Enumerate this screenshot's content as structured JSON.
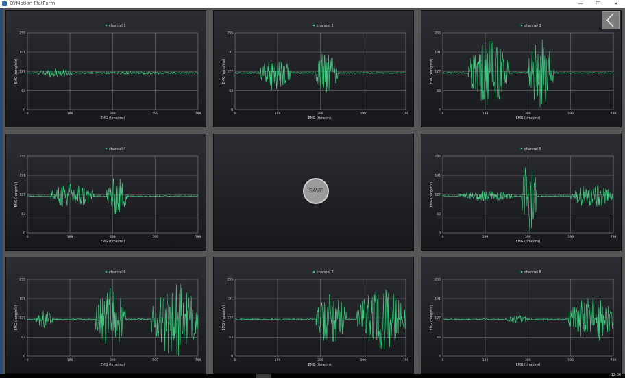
{
  "window": {
    "title": "OYMotion PlatForm",
    "minimize_icon": "—",
    "maximize_icon": "❐",
    "close_icon": "✕"
  },
  "back_button": {
    "icon": "chevron-left-icon"
  },
  "save_button": {
    "label": "SAVE"
  },
  "taskbar": {
    "clock": "12:00"
  },
  "colors": {
    "signal": "#3fc97f",
    "grid": "#6b6e76",
    "axis_text": "#d8d8d8",
    "panel_top": "#2b2d32",
    "panel_bottom": "#17181b"
  },
  "chart_data": [
    {
      "type": "line",
      "legend": "channel 1",
      "xlabel": "EMG (time/ms)",
      "ylabel": "EMG (rang/mV)",
      "xlim": [
        0,
        799
      ],
      "ylim": [
        0,
        255
      ],
      "x_ticks": [
        "0",
        "199",
        "399",
        "599",
        "799"
      ],
      "y_ticks": [
        "0",
        "63",
        "127",
        "191",
        "255"
      ],
      "baseline": 122,
      "bursts": [
        {
          "start": 50,
          "end": 210,
          "amp": 14
        },
        {
          "start": 210,
          "end": 799,
          "amp": 4
        }
      ]
    },
    {
      "type": "line",
      "legend": "channel 2",
      "xlabel": "EMG (time/ms)",
      "ylabel": "EMG (rang/mV)",
      "xlim": [
        0,
        799
      ],
      "ylim": [
        0,
        255
      ],
      "x_ticks": [
        "0",
        "199",
        "399",
        "599",
        "799"
      ],
      "y_ticks": [
        "0",
        "63",
        "127",
        "191",
        "255"
      ],
      "baseline": 122,
      "bursts": [
        {
          "start": 120,
          "end": 260,
          "amp": 60
        },
        {
          "start": 380,
          "end": 480,
          "amp": 75
        }
      ]
    },
    {
      "type": "line",
      "legend": "channel 3",
      "xlabel": "EMG (time/ms)",
      "ylabel": "EMG (rang/mV)",
      "xlim": [
        0,
        799
      ],
      "ylim": [
        0,
        255
      ],
      "x_ticks": [
        "0",
        "199",
        "399",
        "599",
        "799"
      ],
      "y_ticks": [
        "0",
        "63",
        "127",
        "191",
        "255"
      ],
      "baseline": 122,
      "bursts": [
        {
          "start": 120,
          "end": 310,
          "amp": 110
        },
        {
          "start": 400,
          "end": 520,
          "amp": 120
        }
      ]
    },
    {
      "type": "line",
      "legend": "channel 4",
      "xlabel": "EMG (time/ms)",
      "ylabel": "EMG (rang/mV)",
      "xlim": [
        0,
        799
      ],
      "ylim": [
        0,
        255
      ],
      "x_ticks": [
        "0",
        "199",
        "399",
        "599",
        "799"
      ],
      "y_ticks": [
        "0",
        "63",
        "127",
        "191",
        "255"
      ],
      "baseline": 122,
      "bursts": [
        {
          "start": 110,
          "end": 310,
          "amp": 45
        },
        {
          "start": 370,
          "end": 470,
          "amp": 65
        }
      ]
    },
    null,
    {
      "type": "line",
      "legend": "channel 5",
      "xlabel": "EMG (time/ms)",
      "ylabel": "EMG (rang/mV)",
      "xlim": [
        0,
        799
      ],
      "ylim": [
        0,
        255
      ],
      "x_ticks": [
        "0",
        "199",
        "399",
        "599",
        "799"
      ],
      "y_ticks": [
        "0",
        "63",
        "127",
        "191",
        "255"
      ],
      "baseline": 122,
      "bursts": [
        {
          "start": 80,
          "end": 330,
          "amp": 18
        },
        {
          "start": 370,
          "end": 440,
          "amp": 125
        },
        {
          "start": 600,
          "end": 799,
          "amp": 40
        }
      ]
    },
    {
      "type": "line",
      "legend": "channel 6",
      "xlabel": "EMG (time/ms)",
      "ylabel": "EMG (rang/mV)",
      "xlim": [
        0,
        799
      ],
      "ylim": [
        0,
        255
      ],
      "x_ticks": [
        "0",
        "199",
        "399",
        "599",
        "799"
      ],
      "y_ticks": [
        "0",
        "63",
        "127",
        "191",
        "255"
      ],
      "baseline": 122,
      "bursts": [
        {
          "start": 40,
          "end": 120,
          "amp": 30
        },
        {
          "start": 320,
          "end": 460,
          "amp": 105
        },
        {
          "start": 580,
          "end": 799,
          "amp": 125
        }
      ]
    },
    {
      "type": "line",
      "legend": "channel 7",
      "xlabel": "EMG (time/ms)",
      "ylabel": "EMG (rang/mV)",
      "xlim": [
        0,
        799
      ],
      "ylim": [
        0,
        255
      ],
      "x_ticks": [
        "0",
        "199",
        "399",
        "599",
        "799"
      ],
      "y_ticks": [
        "0",
        "63",
        "127",
        "191",
        "255"
      ],
      "baseline": 122,
      "bursts": [
        {
          "start": 380,
          "end": 520,
          "amp": 90
        },
        {
          "start": 570,
          "end": 799,
          "amp": 105
        }
      ]
    },
    {
      "type": "line",
      "legend": "channel 8",
      "xlabel": "EMG (time/ms)",
      "ylabel": "EMG (rang/mV)",
      "xlim": [
        0,
        799
      ],
      "ylim": [
        0,
        255
      ],
      "x_ticks": [
        "0",
        "199",
        "399",
        "599",
        "799"
      ],
      "y_ticks": [
        "0",
        "63",
        "127",
        "191",
        "255"
      ],
      "baseline": 122,
      "bursts": [
        {
          "start": 300,
          "end": 400,
          "amp": 14
        },
        {
          "start": 590,
          "end": 799,
          "amp": 80
        }
      ]
    }
  ]
}
